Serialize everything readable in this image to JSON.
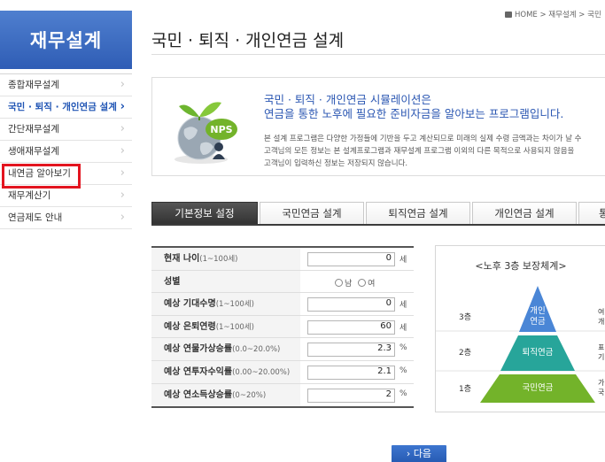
{
  "sidebar": {
    "header": "재무설계",
    "items": [
      {
        "label": "종합재무설계"
      },
      {
        "label": "국민 · 퇴직 · 개인연금 설계"
      },
      {
        "label": "간단재무설계"
      },
      {
        "label": "생애재무설계"
      },
      {
        "label": "내연금 알아보기"
      },
      {
        "label": "재무계산기"
      },
      {
        "label": "연금제도 안내"
      }
    ],
    "chevron": "›"
  },
  "breadcrumb": "HOME > 재무설계 > 국민",
  "page_title": "국민 · 퇴직 · 개인연금 설계",
  "intro": {
    "heading1": "국민 · 퇴직 · 개인연금 시뮬레이션은",
    "heading2": "연금을 통한 노후에 필요한 준비자금을 알아보는 프로그램입니다.",
    "line1": "본 설계 프로그램은 다양한 가정들에 기반을 두고 계산되므로 미래의 실제 수령 금액과는 차이가 날 수",
    "line2": "고객님의 모든 정보는 본 설계프로그램과 재무설계 프로그램 이외의 다른 목적으로 사용되지 않음을",
    "line3": "고객님이 입력하신 정보는 저장되지 않습니다.",
    "badge": "NPS"
  },
  "tabs": [
    {
      "label": "기본정보 설정"
    },
    {
      "label": "국민연금 설계"
    },
    {
      "label": "퇴직연금 설계"
    },
    {
      "label": "개인연금 설계"
    },
    {
      "label": "통"
    }
  ],
  "form": {
    "rows": [
      {
        "label": "현재 나이",
        "hint": "(1~100세)",
        "value": "0",
        "unit": "세"
      },
      {
        "label": "성별",
        "hint": "",
        "options": [
          "남",
          "여"
        ]
      },
      {
        "label": "예상 기대수명",
        "hint": "(1~100세)",
        "value": "0",
        "unit": "세"
      },
      {
        "label": "예상 은퇴연령",
        "hint": "(1~100세)",
        "value": "60",
        "unit": "세"
      },
      {
        "label": "예상 연물가상승률",
        "hint": "(0.0~20.0%)",
        "value": "2.3",
        "unit": "%"
      },
      {
        "label": "예상 연투자수익률",
        "hint": "(0.00~20.00%)",
        "value": "2.1",
        "unit": "%"
      },
      {
        "label": "예상 연소득상승률",
        "hint": "(0~20%)",
        "value": "2",
        "unit": "%"
      }
    ]
  },
  "pyramid": {
    "title": "<노후 3층 보장체계>",
    "levels": [
      {
        "side": "3층",
        "label1": "개인",
        "label2": "연금",
        "right1": "여",
        "right2": "개인",
        "color": "#4a86d6"
      },
      {
        "side": "2층",
        "label1": "퇴직연금",
        "label2": "",
        "right1": "표",
        "right2": "기",
        "color": "#27a59a"
      },
      {
        "side": "1층",
        "label1": "국민연금",
        "label2": "",
        "right1": "가",
        "right2": "국",
        "color": "#73b32a"
      }
    ]
  },
  "next_button": "› 다음",
  "colors": {
    "brand": "#2f5db5",
    "highlight": "#e3141f",
    "active_tab": "#333333"
  }
}
